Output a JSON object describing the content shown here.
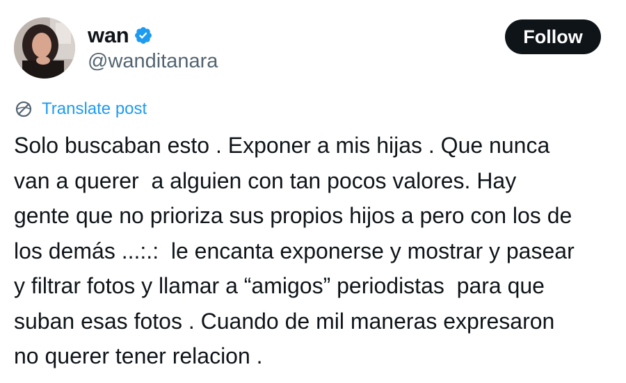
{
  "author": {
    "display_name": "wan",
    "handle": "@wanditanara",
    "verified": true,
    "verified_color": "#1d9bf0"
  },
  "follow_button": {
    "label": "Follow",
    "bg_color": "#0f1419",
    "text_color": "#ffffff"
  },
  "translate": {
    "label": "Translate post",
    "icon": "translate-globe-icon",
    "color": "#1d9bf0"
  },
  "post": {
    "lines": [
      "Solo buscaban esto . Exponer a mis hijas . Que nunca",
      "van a querer  a alguien con tan pocos valores. Hay",
      "gente que no prioriza sus propios hijos a pero con los de",
      "los demás ...:.:  le encanta exponerse y mostrar y pasear",
      "y filtrar fotos y llamar a “amigos” periodistas  para que",
      "suban esas fotos . Cuando de mil maneras expresaron",
      "no querer tener relacion ."
    ]
  }
}
